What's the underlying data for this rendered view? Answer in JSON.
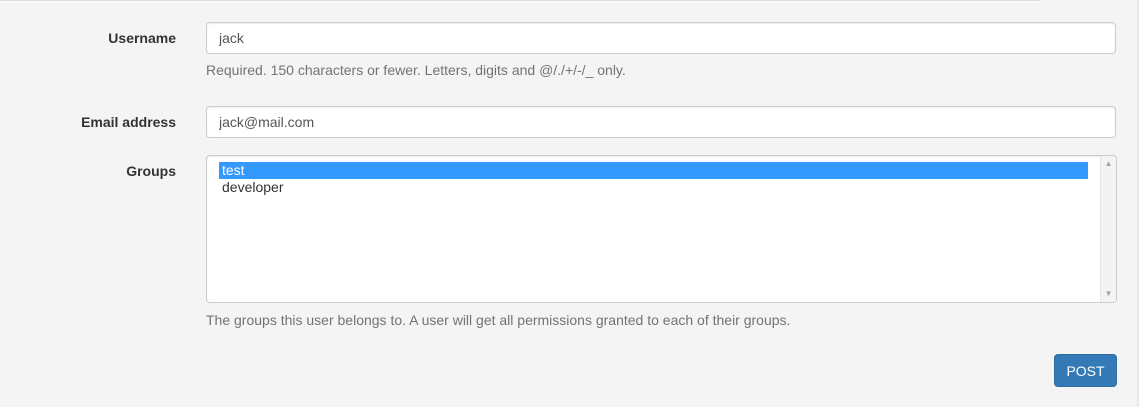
{
  "form": {
    "username": {
      "label": "Username",
      "value": "jack",
      "help": "Required. 150 characters or fewer. Letters, digits and @/./+/-/_ only."
    },
    "email": {
      "label": "Email address",
      "value": "jack@mail.com"
    },
    "groups": {
      "label": "Groups",
      "options": [
        {
          "label": "test",
          "selected": true
        },
        {
          "label": "developer",
          "selected": false
        }
      ],
      "help": "The groups this user belongs to. A user will get all permissions granted to each of their groups."
    },
    "submit_label": "POST"
  },
  "colors": {
    "selection": "#3399ff",
    "primary_button": "#337ab7"
  },
  "icons": {
    "scroll_up": "triangle-up",
    "scroll_down": "triangle-down"
  }
}
